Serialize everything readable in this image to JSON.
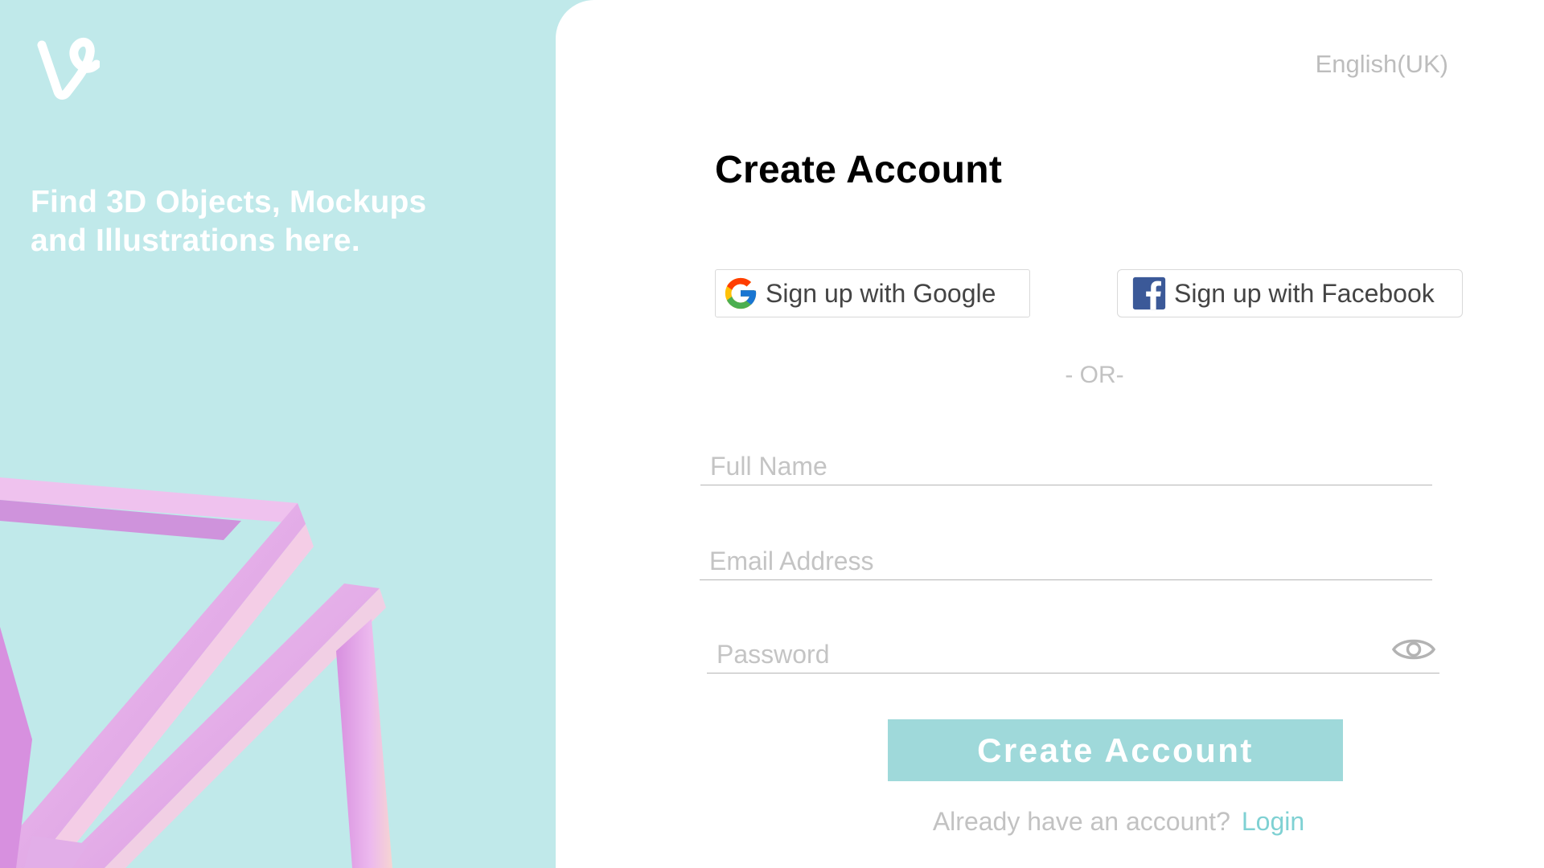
{
  "brand": {
    "logo_icon": "vine-logo-icon",
    "tagline": "Find 3D Objects, Mockups and Illustrations here."
  },
  "colors": {
    "left_background": "#c0e9ea",
    "accent": "#9fd9da",
    "link": "#7fd1d3",
    "decor": "#e9b6ec"
  },
  "header": {
    "language": "English(UK)"
  },
  "form": {
    "title": "Create Account",
    "google_label": "Sign up with Google",
    "facebook_label": "Sign up with Facebook",
    "divider": "- OR-",
    "full_name_placeholder": "Full Name",
    "email_placeholder": "Email Address",
    "password_placeholder": "Password",
    "password_toggle_icon": "eye-icon",
    "submit_label": "Create Account",
    "login_prompt": "Already have an account?",
    "login_link": "Login"
  }
}
